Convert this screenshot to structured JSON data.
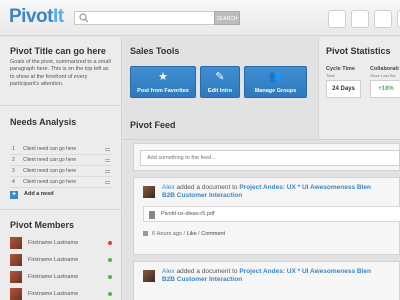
{
  "header": {
    "logo_part1": "Pivot",
    "logo_part2": "It",
    "search_placeholder": "",
    "search_button": "SEARCH"
  },
  "sidebar": {
    "pivot_title": "Pivot Title can go here",
    "pivot_description": "Goals of the pivot, summarized to a small paragraph here. This is on the top left as to show at the forefront of every participant's attention.",
    "needs_title": "Needs Analysis",
    "needs": [
      {
        "num": "1",
        "text": "Client need can go here"
      },
      {
        "num": "2",
        "text": "Client need can go here"
      },
      {
        "num": "3",
        "text": "Client need can go here"
      },
      {
        "num": "4",
        "text": "Client need can go here"
      }
    ],
    "add_need_label": "Add a need",
    "members_title": "Pivot Members",
    "members": [
      {
        "name": "Firstname Lastname",
        "status_color": "#dd3b3b"
      },
      {
        "name": "Firstname Lastname",
        "status_color": "#4cb84c"
      },
      {
        "name": "Firstname Lastname",
        "status_color": "#4cb84c"
      },
      {
        "name": "Firstname Lastname",
        "status_color": "#4cb84c"
      }
    ]
  },
  "tools": {
    "title": "Sales Tools",
    "buttons": [
      {
        "label": "Post from Favorites",
        "icon": "star-icon"
      },
      {
        "label": "Edit Intro",
        "icon": "edit-icon"
      },
      {
        "label": "Manage Groups",
        "icon": "group-icon"
      }
    ]
  },
  "stats": {
    "title": "Pivot Statistics",
    "cycle_label": "Cycle Time",
    "cycle_sub": "Total",
    "cycle_value": "24 Days",
    "collab_label": "Collaborati",
    "collab_sub": "Since Last We",
    "collab_value": "+18%"
  },
  "feed": {
    "title": "Pivot Feed",
    "input_placeholder": "Add something to the feed...",
    "posts": [
      {
        "user": "Alex",
        "action": " added a document to ",
        "project": "Project Andes: UX * UI Awesomeness Blen",
        "project_line2": "B2B Customer Interaction",
        "attachment": "Pivotit-ux-ideas-r5.pdf",
        "time": "6 Hours ago",
        "sep": " / ",
        "like": "Like",
        "comment": "Comment"
      },
      {
        "user": "Alex",
        "action": " added a document to ",
        "project": "Project Andes: UX * UI Awesomeness Blen",
        "project_line2": "B2B Customer Interaction"
      }
    ]
  },
  "colors": {
    "accent": "#3a86c6",
    "positive": "#4cb84c",
    "negative": "#dd3b3b"
  }
}
